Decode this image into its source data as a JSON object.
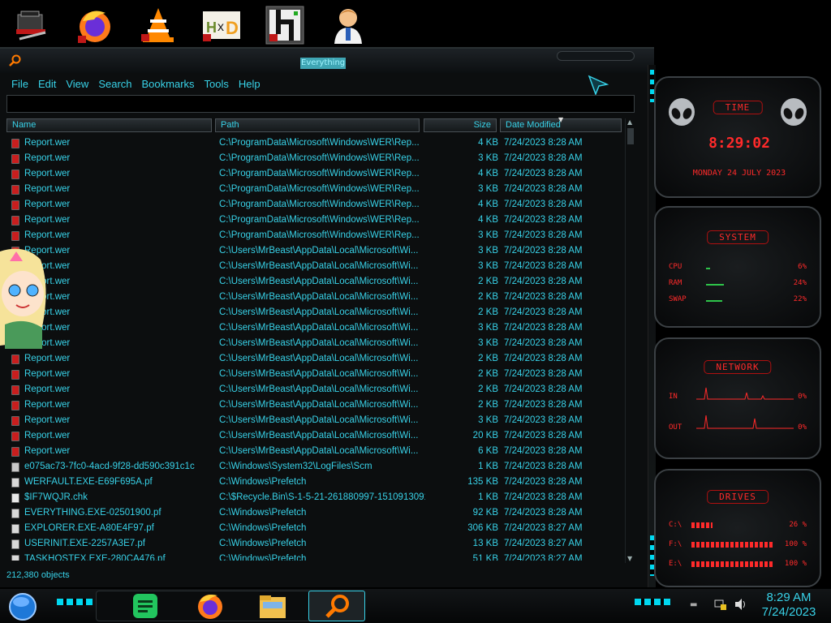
{
  "window": {
    "title": "Everything"
  },
  "menu": [
    "File",
    "Edit",
    "View",
    "Search",
    "Bookmarks",
    "Tools",
    "Help"
  ],
  "search": {
    "value": ""
  },
  "columns": {
    "name": "Name",
    "path": "Path",
    "size": "Size",
    "date": "Date Modified"
  },
  "files": [
    {
      "name": "Report.wer",
      "path": "C:\\ProgramData\\Microsoft\\Windows\\WER\\Rep...",
      "size": "4 KB",
      "date": "7/24/2023 8:28 AM",
      "icon": "wer-file-icon"
    },
    {
      "name": "Report.wer",
      "path": "C:\\ProgramData\\Microsoft\\Windows\\WER\\Rep...",
      "size": "3 KB",
      "date": "7/24/2023 8:28 AM",
      "icon": "wer-file-icon"
    },
    {
      "name": "Report.wer",
      "path": "C:\\ProgramData\\Microsoft\\Windows\\WER\\Rep...",
      "size": "4 KB",
      "date": "7/24/2023 8:28 AM",
      "icon": "wer-file-icon"
    },
    {
      "name": "Report.wer",
      "path": "C:\\ProgramData\\Microsoft\\Windows\\WER\\Rep...",
      "size": "3 KB",
      "date": "7/24/2023 8:28 AM",
      "icon": "wer-file-icon"
    },
    {
      "name": "Report.wer",
      "path": "C:\\ProgramData\\Microsoft\\Windows\\WER\\Rep...",
      "size": "4 KB",
      "date": "7/24/2023 8:28 AM",
      "icon": "wer-file-icon"
    },
    {
      "name": "Report.wer",
      "path": "C:\\ProgramData\\Microsoft\\Windows\\WER\\Rep...",
      "size": "4 KB",
      "date": "7/24/2023 8:28 AM",
      "icon": "wer-file-icon"
    },
    {
      "name": "Report.wer",
      "path": "C:\\ProgramData\\Microsoft\\Windows\\WER\\Rep...",
      "size": "3 KB",
      "date": "7/24/2023 8:28 AM",
      "icon": "wer-file-icon"
    },
    {
      "name": "Report.wer",
      "path": "C:\\Users\\MrBeast\\AppData\\Local\\Microsoft\\Wi...",
      "size": "3 KB",
      "date": "7/24/2023 8:28 AM",
      "icon": "wer-file-icon"
    },
    {
      "name": "Report.wer",
      "path": "C:\\Users\\MrBeast\\AppData\\Local\\Microsoft\\Wi...",
      "size": "3 KB",
      "date": "7/24/2023 8:28 AM",
      "icon": "wer-file-icon"
    },
    {
      "name": "Report.wer",
      "path": "C:\\Users\\MrBeast\\AppData\\Local\\Microsoft\\Wi...",
      "size": "2 KB",
      "date": "7/24/2023 8:28 AM",
      "icon": "wer-file-icon"
    },
    {
      "name": "Report.wer",
      "path": "C:\\Users\\MrBeast\\AppData\\Local\\Microsoft\\Wi...",
      "size": "2 KB",
      "date": "7/24/2023 8:28 AM",
      "icon": "wer-file-icon"
    },
    {
      "name": "Report.wer",
      "path": "C:\\Users\\MrBeast\\AppData\\Local\\Microsoft\\Wi...",
      "size": "2 KB",
      "date": "7/24/2023 8:28 AM",
      "icon": "wer-file-icon"
    },
    {
      "name": "Report.wer",
      "path": "C:\\Users\\MrBeast\\AppData\\Local\\Microsoft\\Wi...",
      "size": "3 KB",
      "date": "7/24/2023 8:28 AM",
      "icon": "wer-file-icon"
    },
    {
      "name": "Report.wer",
      "path": "C:\\Users\\MrBeast\\AppData\\Local\\Microsoft\\Wi...",
      "size": "3 KB",
      "date": "7/24/2023 8:28 AM",
      "icon": "wer-file-icon"
    },
    {
      "name": "Report.wer",
      "path": "C:\\Users\\MrBeast\\AppData\\Local\\Microsoft\\Wi...",
      "size": "2 KB",
      "date": "7/24/2023 8:28 AM",
      "icon": "wer-file-icon"
    },
    {
      "name": "Report.wer",
      "path": "C:\\Users\\MrBeast\\AppData\\Local\\Microsoft\\Wi...",
      "size": "2 KB",
      "date": "7/24/2023 8:28 AM",
      "icon": "wer-file-icon"
    },
    {
      "name": "Report.wer",
      "path": "C:\\Users\\MrBeast\\AppData\\Local\\Microsoft\\Wi...",
      "size": "2 KB",
      "date": "7/24/2023 8:28 AM",
      "icon": "wer-file-icon"
    },
    {
      "name": "Report.wer",
      "path": "C:\\Users\\MrBeast\\AppData\\Local\\Microsoft\\Wi...",
      "size": "2 KB",
      "date": "7/24/2023 8:28 AM",
      "icon": "wer-file-icon"
    },
    {
      "name": "Report.wer",
      "path": "C:\\Users\\MrBeast\\AppData\\Local\\Microsoft\\Wi...",
      "size": "3 KB",
      "date": "7/24/2023 8:28 AM",
      "icon": "wer-file-icon"
    },
    {
      "name": "Report.wer",
      "path": "C:\\Users\\MrBeast\\AppData\\Local\\Microsoft\\Wi...",
      "size": "20 KB",
      "date": "7/24/2023 8:28 AM",
      "icon": "wer-file-icon"
    },
    {
      "name": "Report.wer",
      "path": "C:\\Users\\MrBeast\\AppData\\Local\\Microsoft\\Wi...",
      "size": "6 KB",
      "date": "7/24/2023 8:28 AM",
      "icon": "wer-file-icon"
    },
    {
      "name": "e075ac73-7fc0-4acd-9f28-dd590c391c1c",
      "path": "C:\\Windows\\System32\\LogFiles\\Scm",
      "size": "1 KB",
      "date": "7/24/2023 8:28 AM",
      "icon": "file-icon"
    },
    {
      "name": "WERFAULT.EXE-E69F695A.pf",
      "path": "C:\\Windows\\Prefetch",
      "size": "135 KB",
      "date": "7/24/2023 8:28 AM",
      "icon": "prefetch-file-icon"
    },
    {
      "name": "$IF7WQJR.chk",
      "path": "C:\\$Recycle.Bin\\S-1-5-21-261880997-1510913091-...",
      "size": "1 KB",
      "date": "7/24/2023 8:28 AM",
      "icon": "chk-file-icon"
    },
    {
      "name": "EVERYTHING.EXE-02501900.pf",
      "path": "C:\\Windows\\Prefetch",
      "size": "92 KB",
      "date": "7/24/2023 8:28 AM",
      "icon": "prefetch-file-icon"
    },
    {
      "name": "EXPLORER.EXE-A80E4F97.pf",
      "path": "C:\\Windows\\Prefetch",
      "size": "306 KB",
      "date": "7/24/2023 8:27 AM",
      "icon": "prefetch-file-icon"
    },
    {
      "name": "USERINIT.EXE-2257A3E7.pf",
      "path": "C:\\Windows\\Prefetch",
      "size": "13 KB",
      "date": "7/24/2023 8:27 AM",
      "icon": "prefetch-file-icon"
    },
    {
      "name": "TASKHOSTEX.EXE-280CA476.pf",
      "path": "C:\\Windows\\Prefetch",
      "size": "51 KB",
      "date": "7/24/2023 8:27 AM",
      "icon": "prefetch-file-icon"
    }
  ],
  "status": {
    "count": "212,380 objects"
  },
  "gadgets": {
    "time": {
      "title": "TIME",
      "clock": "8:29:02",
      "date": "MONDAY 24 JULY 2023"
    },
    "system": {
      "title": "SYSTEM",
      "metrics": [
        {
          "label": "CPU",
          "value": "6%",
          "level": 0.06
        },
        {
          "label": "RAM",
          "value": "24%",
          "level": 0.24
        },
        {
          "label": "SWAP",
          "value": "22%",
          "level": 0.22
        }
      ]
    },
    "network": {
      "title": "NETWORK",
      "metrics": [
        {
          "label": "IN",
          "value": "0%"
        },
        {
          "label": "OUT",
          "value": "0%"
        }
      ]
    },
    "drives": {
      "title": "DRIVES",
      "metrics": [
        {
          "label": "C:\\",
          "value": "26 %",
          "level": 0.26
        },
        {
          "label": "F:\\",
          "value": "100 %",
          "level": 1.0
        },
        {
          "label": "E:\\",
          "value": "100 %",
          "level": 1.0
        }
      ]
    }
  },
  "taskbar": {
    "time": "8:29 AM",
    "date": "7/24/2023"
  },
  "colors": {
    "accent": "#38d2e8",
    "red": "#ff2a2a",
    "background": "#0c0e0f"
  },
  "desktop_icons": [
    "toolbox-icon",
    "firefox-icon",
    "vlc-icon",
    "hxd-icon",
    "maze-app-icon",
    "doctor-avatar-icon"
  ],
  "taskbar_icons": [
    "start-orb-icon",
    "notes-app-icon",
    "firefox-icon",
    "file-explorer-icon",
    "everything-search-icon"
  ]
}
